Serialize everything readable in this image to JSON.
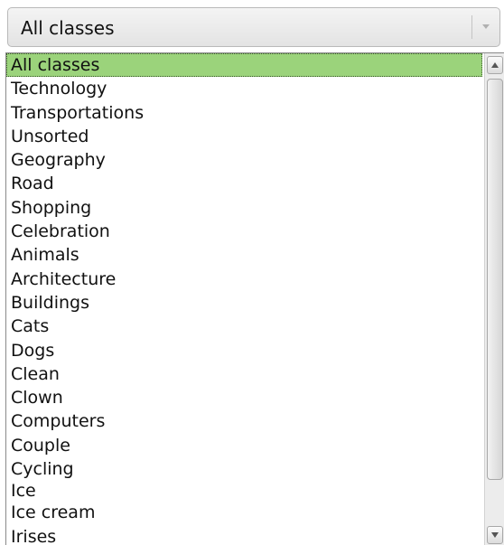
{
  "combo": {
    "selected_value": "All classes"
  },
  "list": {
    "selected_index": 0,
    "items": [
      "All classes",
      "Technology",
      "Transportations",
      "Unsorted",
      "Geography",
      "Road",
      "Shopping",
      "Celebration",
      "Animals",
      "Architecture",
      "Buildings",
      "Cats",
      "Dogs",
      "Clean",
      "Clown",
      "Computers",
      "Couple",
      "Cycling",
      "Ice",
      "Ice cream",
      "Irises"
    ]
  },
  "colors": {
    "selection": "#9bd37b",
    "scrollbar_track": "#ececec"
  },
  "icons": {
    "combo_arrow": "chevron-down-icon",
    "scroll_up": "arrow-up-icon",
    "scroll_down": "arrow-down-icon"
  }
}
